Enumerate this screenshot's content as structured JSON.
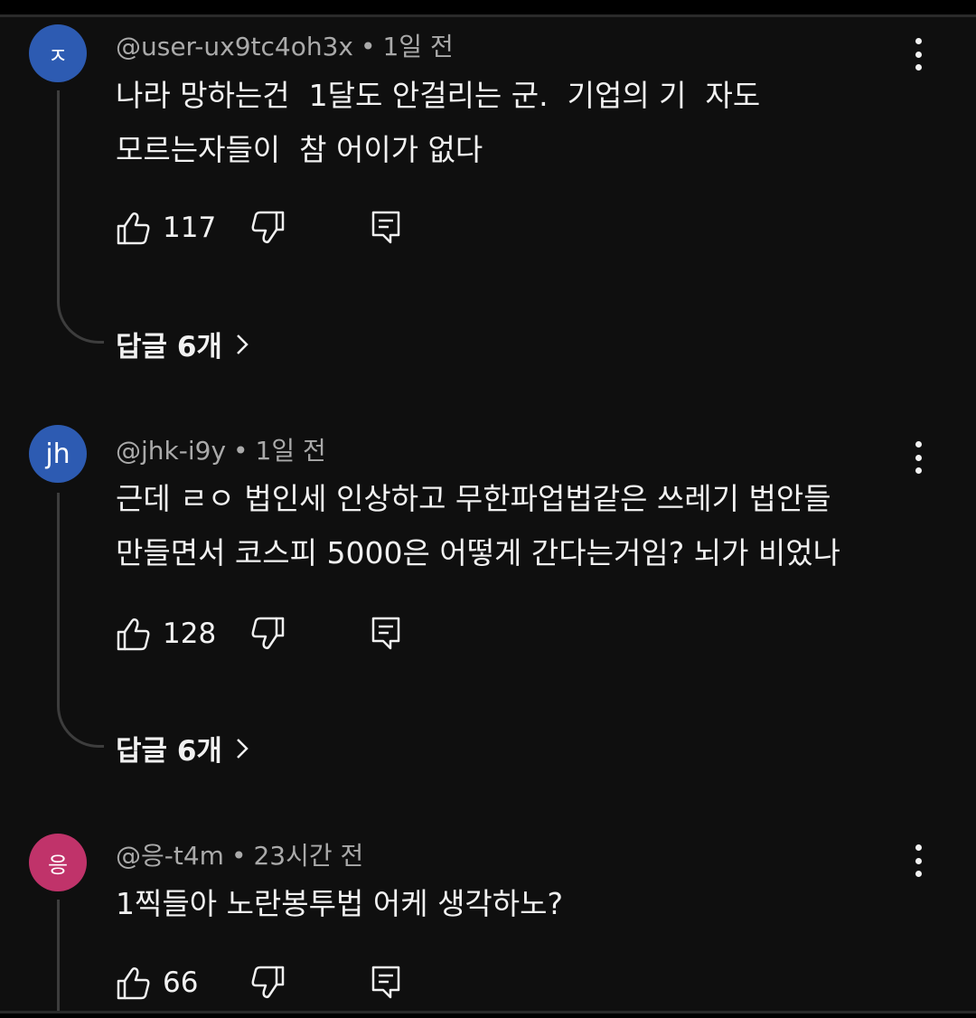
{
  "comments": [
    {
      "avatar": {
        "letter": "ㅈ",
        "color": "#2d5bb2"
      },
      "author": "@user-ux9tc4oh3x",
      "time": "1일 전",
      "text_lines": [
        "나라 망하는건  1달도 안걸리는 군.  기업의 기  자도",
        "모르는자들이  참 어이가 없다"
      ],
      "likes": "117",
      "replies_label": "답글 6개"
    },
    {
      "avatar": {
        "letter": "jh",
        "color": "#2d5bb2"
      },
      "author": "@jhk-i9y",
      "time": "1일 전",
      "text_lines": [
        "근데 ㄹㅇ 법인세 인상하고 무한파업법같은 쓰레기 법안들",
        "만들면서 코스피 5000은 어떻게 간다는거임? 뇌가 비었나"
      ],
      "likes": "128",
      "replies_label": "답글 6개"
    },
    {
      "avatar": {
        "letter": "응",
        "color": "#c0336a"
      },
      "author": "@응-t4m",
      "time": "23시간 전",
      "text_lines": [
        "1찍들아 노란봉투법 어케 생각하노?"
      ],
      "likes": "66"
    }
  ],
  "meta_separator": "•",
  "icons": {
    "like": "thumbs-up-icon",
    "dislike": "thumbs-down-icon",
    "reply": "reply-comment-icon",
    "more": "more-vertical-icon",
    "chevron": "chevron-right-icon"
  }
}
